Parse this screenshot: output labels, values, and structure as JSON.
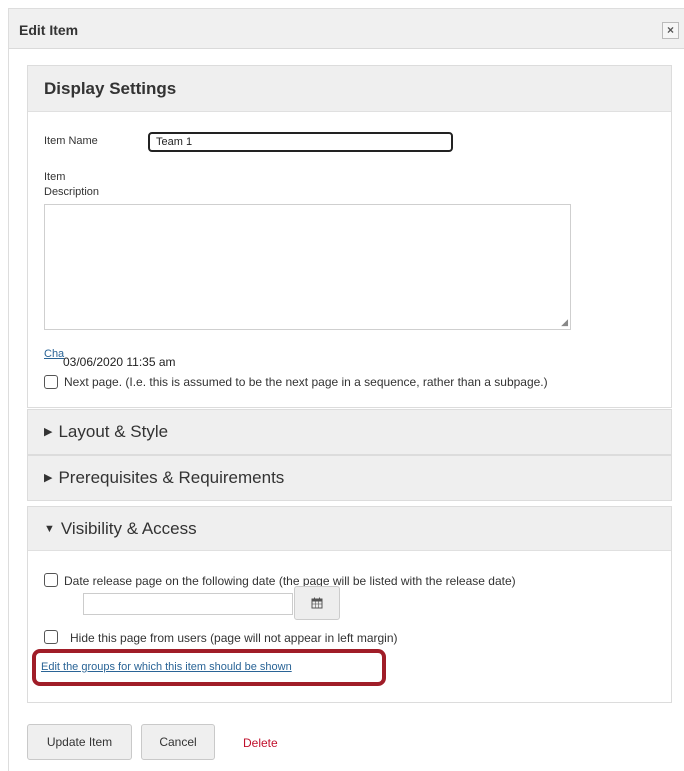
{
  "dialog": {
    "title": "Edit Item",
    "close_glyph": "×",
    "close_icon": "close-icon"
  },
  "display_settings": {
    "header": "Display Settings",
    "item_name_label": "Item Name",
    "item_name_value": "Team 1",
    "item_description_label_line1": "Item",
    "item_description_label_line2": "Description",
    "item_description_value": "",
    "change_link": "Cha",
    "date": "03/06/2020 11:35 am",
    "next_page_label": "Next page. (I.e. this is assumed to be the next page in a sequence, rather than a subpage.)",
    "next_page_checked": false
  },
  "layout_style": {
    "header": "Layout & Style",
    "expanded": false
  },
  "prerequisites": {
    "header": "Prerequisites & Requirements",
    "expanded": false
  },
  "visibility": {
    "header": "Visibility & Access",
    "expanded": true,
    "date_release_label": "Date release page on the following date (the page will be listed with the release date)",
    "date_release_checked": false,
    "release_date_value": "",
    "calendar_icon": "calendar-icon",
    "hide_page_label": "Hide this page from users (page will not appear in left margin)",
    "hide_page_checked": false,
    "groups_link": "Edit the groups for which this item should be shown",
    "highlight_color": "#a01d28"
  },
  "footer": {
    "update_label": "Update Item",
    "cancel_label": "Cancel",
    "delete_label": "Delete"
  },
  "colors": {
    "link": "#2a6496",
    "delete": "#c0102c",
    "panel_header_bg": "#efefef"
  }
}
